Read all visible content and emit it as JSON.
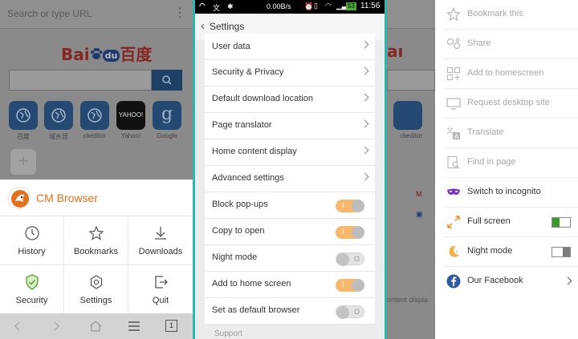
{
  "left": {
    "url_placeholder": "Search or type URL",
    "menu_dots": "⋮",
    "logo_text_left": "Bai",
    "logo_text_du": "du",
    "logo_text_right": "百度",
    "tiles": [
      {
        "label": "百度",
        "glyph": "◍"
      },
      {
        "label": "城乡居",
        "glyph": "◍"
      },
      {
        "label": "ckeditor",
        "glyph": "◍"
      },
      {
        "label": "Yahoo!",
        "glyph": "YAHOO!"
      },
      {
        "label": "Google",
        "glyph": "g"
      }
    ],
    "add_glyph": "+",
    "brand_name": "CM Browser",
    "menu_items": [
      {
        "label": "History",
        "icon": "clock-icon"
      },
      {
        "label": "Bookmarks",
        "icon": "star-icon"
      },
      {
        "label": "Downloads",
        "icon": "download-icon"
      },
      {
        "label": "Security",
        "icon": "shield-icon"
      },
      {
        "label": "Settings",
        "icon": "gear-icon"
      },
      {
        "label": "Quit",
        "icon": "exit-icon"
      }
    ],
    "tab_count": "1"
  },
  "middle": {
    "status": {
      "speed": "0.00B/s",
      "battery": "53",
      "time": "11:56"
    },
    "title": "Settings",
    "rows": [
      {
        "label": "User data",
        "type": "link"
      },
      {
        "label": "Security & Privacy",
        "type": "link"
      },
      {
        "label": "Default download location",
        "type": "link"
      },
      {
        "label": "Page translator",
        "type": "link"
      },
      {
        "label": "Home content display",
        "type": "link"
      },
      {
        "label": "Advanced settings",
        "type": "link"
      },
      {
        "label": "Block pop-ups",
        "type": "toggle",
        "on": true
      },
      {
        "label": "Copy to open",
        "type": "toggle",
        "on": true
      },
      {
        "label": "Night mode",
        "type": "toggle",
        "on": false
      },
      {
        "label": "Add to home screen",
        "type": "toggle",
        "on": true
      },
      {
        "label": "Set as default browser",
        "type": "toggle",
        "on": false
      }
    ],
    "support": "Support"
  },
  "right": {
    "items": [
      {
        "label": "Bookmark this",
        "icon": "star-icon",
        "enabled": false
      },
      {
        "label": "Share",
        "icon": "share-icon",
        "enabled": false
      },
      {
        "label": "Add to homescreen",
        "icon": "add-to-home-icon",
        "enabled": false
      },
      {
        "label": "Request desktop site",
        "icon": "monitor-icon",
        "enabled": false
      },
      {
        "label": "Translate",
        "icon": "translate-icon",
        "enabled": false
      },
      {
        "label": "Find in page",
        "icon": "search-icon",
        "enabled": false
      },
      {
        "label": "Switch to incognito",
        "icon": "mask-icon",
        "enabled": true
      },
      {
        "label": "Full screen",
        "icon": "fullscreen-icon",
        "enabled": true,
        "toggle": "on"
      },
      {
        "label": "Night mode",
        "icon": "moon-icon",
        "enabled": true,
        "toggle": "off"
      },
      {
        "label": "Our Facebook",
        "icon": "facebook-icon",
        "enabled": true,
        "chevron": true
      }
    ],
    "background_snippets": {
      "ckeditor": "ckeditor",
      "content": "ontent displa"
    }
  },
  "colors": {
    "accent_orange": "#f7b76c",
    "brand_orange": "#e2711d",
    "teal_frame": "#2bb6b0",
    "toggle_green": "#3a9a2e"
  }
}
